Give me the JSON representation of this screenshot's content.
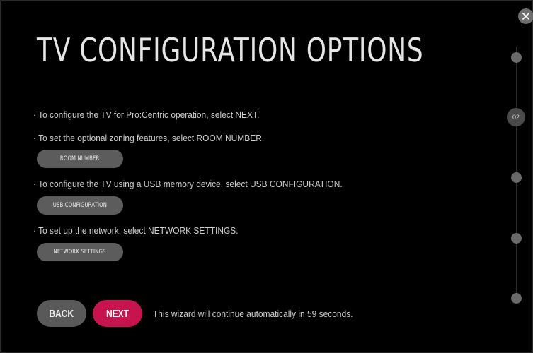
{
  "wizard": {
    "title": "TV CONFIGURATION OPTIONS",
    "instructions": {
      "next_line": "· To configure the TV for Pro:Centric operation, select NEXT.",
      "room_line": "· To set the optional zoning features, select ROOM NUMBER.",
      "usb_line": "· To configure the TV using a USB memory device, select USB CONFIGURATION.",
      "network_line": "· To set up the network, select NETWORK SETTINGS."
    },
    "buttons": {
      "room_number": "ROOM NUMBER",
      "usb_configuration": "USB CONFIGURATION",
      "network_settings": "NETWORK SETTINGS",
      "back": "BACK",
      "next": "NEXT"
    },
    "auto_message": "This wizard will continue automatically in 59 seconds.",
    "close_icon": "close-icon",
    "steps": {
      "current_label": "02",
      "total": 5,
      "current_index": 2
    },
    "colors": {
      "accent": "#c7134e",
      "button_gray": "#5c5c5c",
      "background": "#000000"
    }
  }
}
